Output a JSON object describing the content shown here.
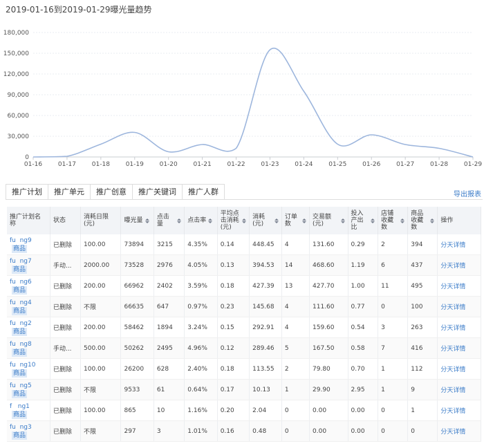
{
  "page": {
    "title": "2019-01-16到2019-01-29曝光量趋势",
    "export_label": "导出报表"
  },
  "tabs": [
    {
      "label": "推广计划",
      "active": true
    },
    {
      "label": "推广单元",
      "active": false
    },
    {
      "label": "推广创意",
      "active": false
    },
    {
      "label": "推广关键词",
      "active": false
    },
    {
      "label": "推广人群",
      "active": false
    }
  ],
  "chart_data": {
    "type": "line",
    "title": "2019-01-16到2019-01-29曝光量趋势",
    "categories": [
      "01-16",
      "01-17",
      "01-18",
      "01-19",
      "01-20",
      "01-21",
      "01-22",
      "01-23",
      "01-24",
      "01-25",
      "01-26",
      "01-27",
      "01-28",
      "01-29"
    ],
    "series": [
      {
        "values": [
          0,
          1000,
          18500,
          35500,
          7500,
          18000,
          12500,
          155000,
          95000,
          18500,
          32000,
          18000,
          12500,
          0
        ]
      }
    ],
    "ylim": [
      0,
      180000
    ],
    "yticks": [
      "0",
      "30,000",
      "60,000",
      "90,000",
      "120,000",
      "150,000",
      "180,000"
    ],
    "ytick_values": [
      0,
      30000,
      60000,
      90000,
      120000,
      150000,
      180000
    ],
    "grid": true,
    "color": "#9db6dd"
  },
  "table": {
    "headers": [
      {
        "label": "推广计划名称",
        "sort": false
      },
      {
        "label": "状态",
        "sort": false
      },
      {
        "label": "消耗日限 (元)",
        "sort": false
      },
      {
        "label": "曝光量",
        "sort": true
      },
      {
        "label": "点击量",
        "sort": true
      },
      {
        "label": "点击率",
        "sort": true
      },
      {
        "label": "平均点击消耗(元)",
        "sort": true
      },
      {
        "label": "消耗(元)",
        "sort": true
      },
      {
        "label": "订单数",
        "sort": true
      },
      {
        "label": "交易额(元)",
        "sort": true
      },
      {
        "label": "投入产出比",
        "sort": true
      },
      {
        "label": "店铺收藏数",
        "sort": true
      },
      {
        "label": "商品收藏数",
        "sort": true
      },
      {
        "label": "操作",
        "sort": false
      }
    ],
    "rows": [
      {
        "name": "fu  ng9",
        "tag": "商品",
        "status": "已删除",
        "limit": "100.00",
        "impr": "73894",
        "clicks": "3215",
        "ctr": "4.35%",
        "cpc": "0.14",
        "cost": "448.45",
        "orders": "4",
        "gmv": "131.60",
        "roi": "0.29",
        "shopfav": "2",
        "itemfav": "394",
        "action": "分天详情"
      },
      {
        "name": "fu  ng7",
        "tag": "商品",
        "status": "手动...",
        "limit": "2000.00",
        "impr": "73528",
        "clicks": "2976",
        "ctr": "4.05%",
        "cpc": "0.13",
        "cost": "394.53",
        "orders": "14",
        "gmv": "468.60",
        "roi": "1.19",
        "shopfav": "6",
        "itemfav": "437",
        "action": "分天详情"
      },
      {
        "name": "fu  ng6",
        "tag": "商品",
        "status": "已删除",
        "limit": "200.00",
        "impr": "66962",
        "clicks": "2402",
        "ctr": "3.59%",
        "cpc": "0.18",
        "cost": "427.39",
        "orders": "13",
        "gmv": "427.70",
        "roi": "1.00",
        "shopfav": "11",
        "itemfav": "495",
        "action": "分天详情"
      },
      {
        "name": "fu  ng4",
        "tag": "商品",
        "status": "已删除",
        "limit": "不限",
        "impr": "66635",
        "clicks": "647",
        "ctr": "0.97%",
        "cpc": "0.23",
        "cost": "145.68",
        "orders": "4",
        "gmv": "111.60",
        "roi": "0.77",
        "shopfav": "0",
        "itemfav": "100",
        "action": "分天详情"
      },
      {
        "name": "fu  ng2",
        "tag": "商品",
        "status": "已删除",
        "limit": "200.00",
        "impr": "58462",
        "clicks": "1894",
        "ctr": "3.24%",
        "cpc": "0.15",
        "cost": "292.91",
        "orders": "4",
        "gmv": "159.60",
        "roi": "0.54",
        "shopfav": "3",
        "itemfav": "263",
        "action": "分天详情"
      },
      {
        "name": "fu  ng8",
        "tag": "商品",
        "status": "手动...",
        "limit": "500.00",
        "impr": "50262",
        "clicks": "2495",
        "ctr": "4.96%",
        "cpc": "0.12",
        "cost": "289.46",
        "orders": "5",
        "gmv": "167.50",
        "roi": "0.58",
        "shopfav": "7",
        "itemfav": "416",
        "action": "分天详情"
      },
      {
        "name": "fu  ng10",
        "tag": "商品",
        "status": "已删除",
        "limit": "100.00",
        "impr": "26200",
        "clicks": "628",
        "ctr": "2.40%",
        "cpc": "0.18",
        "cost": "113.55",
        "orders": "2",
        "gmv": "79.80",
        "roi": "0.70",
        "shopfav": "1",
        "itemfav": "112",
        "action": "分天详情"
      },
      {
        "name": "fu  ng5",
        "tag": "商品",
        "status": "已删除",
        "limit": "不限",
        "impr": "9533",
        "clicks": "61",
        "ctr": "0.64%",
        "cpc": "0.17",
        "cost": "10.13",
        "orders": "1",
        "gmv": "29.90",
        "roi": "2.95",
        "shopfav": "1",
        "itemfav": "9",
        "action": "分天详情"
      },
      {
        "name": "f   ng1",
        "tag": "商品",
        "status": "已删除",
        "limit": "100.00",
        "impr": "865",
        "clicks": "10",
        "ctr": "1.16%",
        "cpc": "0.20",
        "cost": "2.04",
        "orders": "0",
        "gmv": "0.00",
        "roi": "0.00",
        "shopfav": "0",
        "itemfav": "1",
        "action": "分天详情"
      },
      {
        "name": "fu  ng3",
        "tag": "商品",
        "status": "已删除",
        "limit": "不限",
        "impr": "297",
        "clicks": "3",
        "ctr": "1.01%",
        "cpc": "0.16",
        "cost": "0.48",
        "orders": "0",
        "gmv": "0.00",
        "roi": "0.00",
        "shopfav": "0",
        "itemfav": "0",
        "action": "分天详情"
      }
    ]
  }
}
